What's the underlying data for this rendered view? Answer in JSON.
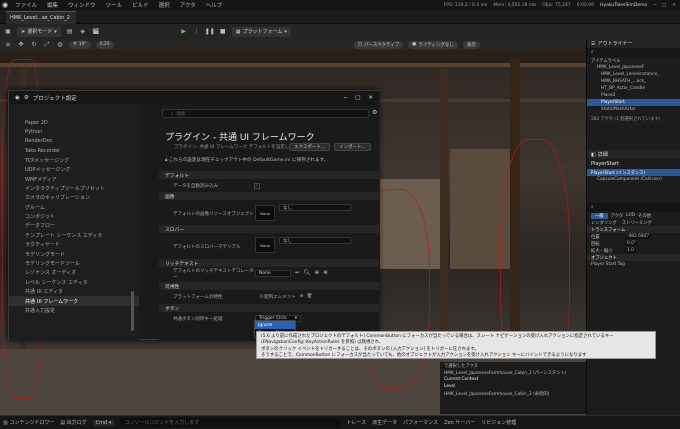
{
  "menu": {
    "items": [
      "ファイル",
      "編集",
      "ウィンドウ",
      "ツール",
      "ビルド",
      "選択",
      "アクタ",
      "ヘルプ"
    ]
  },
  "stats": {
    "fps_label": "FPS:",
    "fps": "119.2 / 8.4 ms",
    "mem_label": "Mem:",
    "mem": "4,502.18 mb",
    "objs_label": "Objs:",
    "objs": "75,247",
    "time": "0:00:00",
    "project": "HyakuTalesSimDemo"
  },
  "tabs": [
    {
      "label": "HMK_Level...se_Cabin_2"
    }
  ],
  "toolbar": {
    "mode": "選択モード",
    "platform": "プラットフォーム",
    "grid": "10°",
    "snap": "0.25"
  },
  "viewport": {
    "perspective": "パースペクティブ",
    "lighting": "ライティングなし",
    "show": "表示"
  },
  "outliner": {
    "title": "アウトライナー",
    "items": [
      "アイテムラベル",
      "HMK_Level_JapaneseF",
      "HMK_Level_Lenseinstance_",
      "HMK_BHSATH_...ock_",
      "HT_BP_Actor_Candle",
      "Plane2",
      "PlayerStart",
      "StaticMeshActor"
    ],
    "footer": "282 アクタ (1 個選択されています)"
  },
  "details": {
    "title": "詳細",
    "actor": "PlayerStart",
    "instance": "PlayerStart (インスタンス)",
    "component": "CapsuleComponent (Collision)",
    "tabs": [
      "一般",
      "アクタ",
      "LOD",
      "その他",
      "レンダリング",
      "ストリーミング"
    ],
    "transform": "トランスフォーム",
    "location_label": "位置",
    "rotation_label": "回転",
    "scale_label": "拡大・縮小",
    "location": [
      "-482.6847",
      "0.0",
      "-0.0"
    ],
    "rotation": [
      "0.0°",
      "0.0°",
      "0.0°"
    ],
    "scale": [
      "1.0",
      "1.0",
      "1.0"
    ],
    "object_label": "オブジェクト",
    "player_start_tag": "Player Start Tag",
    "selected_actor": "で選択したアクタ",
    "selected_actor_value": "HMK_Level_JapaneseFarmhouse_Cabin_2 (パーシスタント)",
    "current_context": "Current Context",
    "level_label": "Level",
    "level_value": "HMK_Level_JapaneseFarmhouse_Cabin_2 (永続的)"
  },
  "dialog": {
    "title": "プロジェクト設定",
    "search_placeholder": "検索",
    "heading": "プラグイン - 共通 UI フレームワーク",
    "subtitle": "プラグイン: 共通 UI フレームワーク デフォルトを設定します。",
    "export": "エクスポート...",
    "import": "インポート...",
    "notice": "これらの設定は現在チェックアウト中の DefaultGame.ini に保存されます。",
    "categories": [
      "Paper 2D",
      "Python",
      "RenderDoc",
      "Take Recorder",
      "TCPメッセージング",
      "UDPメッセージング",
      "WMFメディア",
      "インタラクティブツールプリセット",
      "カメラのキャリブレーション",
      "グルーム",
      "コンポジット",
      "データフロー",
      "テンプレート シーケンス エディタ",
      "ラクティヤード",
      "モデリングモード",
      "モデリングモードツール",
      "レゾナンス オーディオ",
      "レベル シーケンス エディタ",
      "共通 UI エディタ",
      "共通 UI フレームワーク",
      "共通入力設定"
    ],
    "selected_category": "共通 UI フレームワーク",
    "sections": {
      "default": "デフォルト",
      "brush": "画像",
      "throbber": "スロバー",
      "richtext": "リッチテキスト",
      "visibility": "可視性",
      "button": "ボタン"
    },
    "props": {
      "auto_load": "データを自動読み込み",
      "default_image_resource": "デフォルトの画像リソースオブジェクト",
      "default_throbber_material": "デフォルトのスロバーマテリアル",
      "default_richtext_decorator": "デフォルトのリッチテキストデコレーター",
      "platform_visibility": "プラットフォームの特性",
      "button_input_style": "共通ボタン同時キー処理"
    },
    "none": "None",
    "nashi": "なし",
    "richtext_value": "None",
    "array_value": "0 配列エレメント",
    "button_value": "Trigger Click",
    "options": [
      "Ignore",
      "Trigger Click"
    ],
    "selected_option": "Ignore"
  },
  "tooltip": {
    "lines": [
      "(5.6 より前に作成されたプロジェクトのデフォルト) CommonButton にフォーカスが当たっている場合は、スレート ナビゲーションの受け入れアクションに指定されているキー",
      "(FNavigationConfig::KeyActionRules を参照) は無視され、",
      "ボタンのクリック イベントをトリガーすることは、そのボタンの [入力アクション] をトリガーに任されます。",
      "そうすることで、CommonButton にフォーカスが当たっていても、他のオブジェクトが入力アクションを受け入れアクション キーにバインドできるようになります"
    ]
  },
  "statusbar": {
    "content_drawer": "コンテンツドロワー",
    "output_log": "出力ログ",
    "cmd": "Cmd",
    "console_placeholder": "コンソールコマンドを入力します",
    "trace": "トレース",
    "derived_data": "派生データ",
    "performance": "パフォーマンス",
    "zen": "Zen サーバー",
    "revision": "リビジョン管理"
  }
}
